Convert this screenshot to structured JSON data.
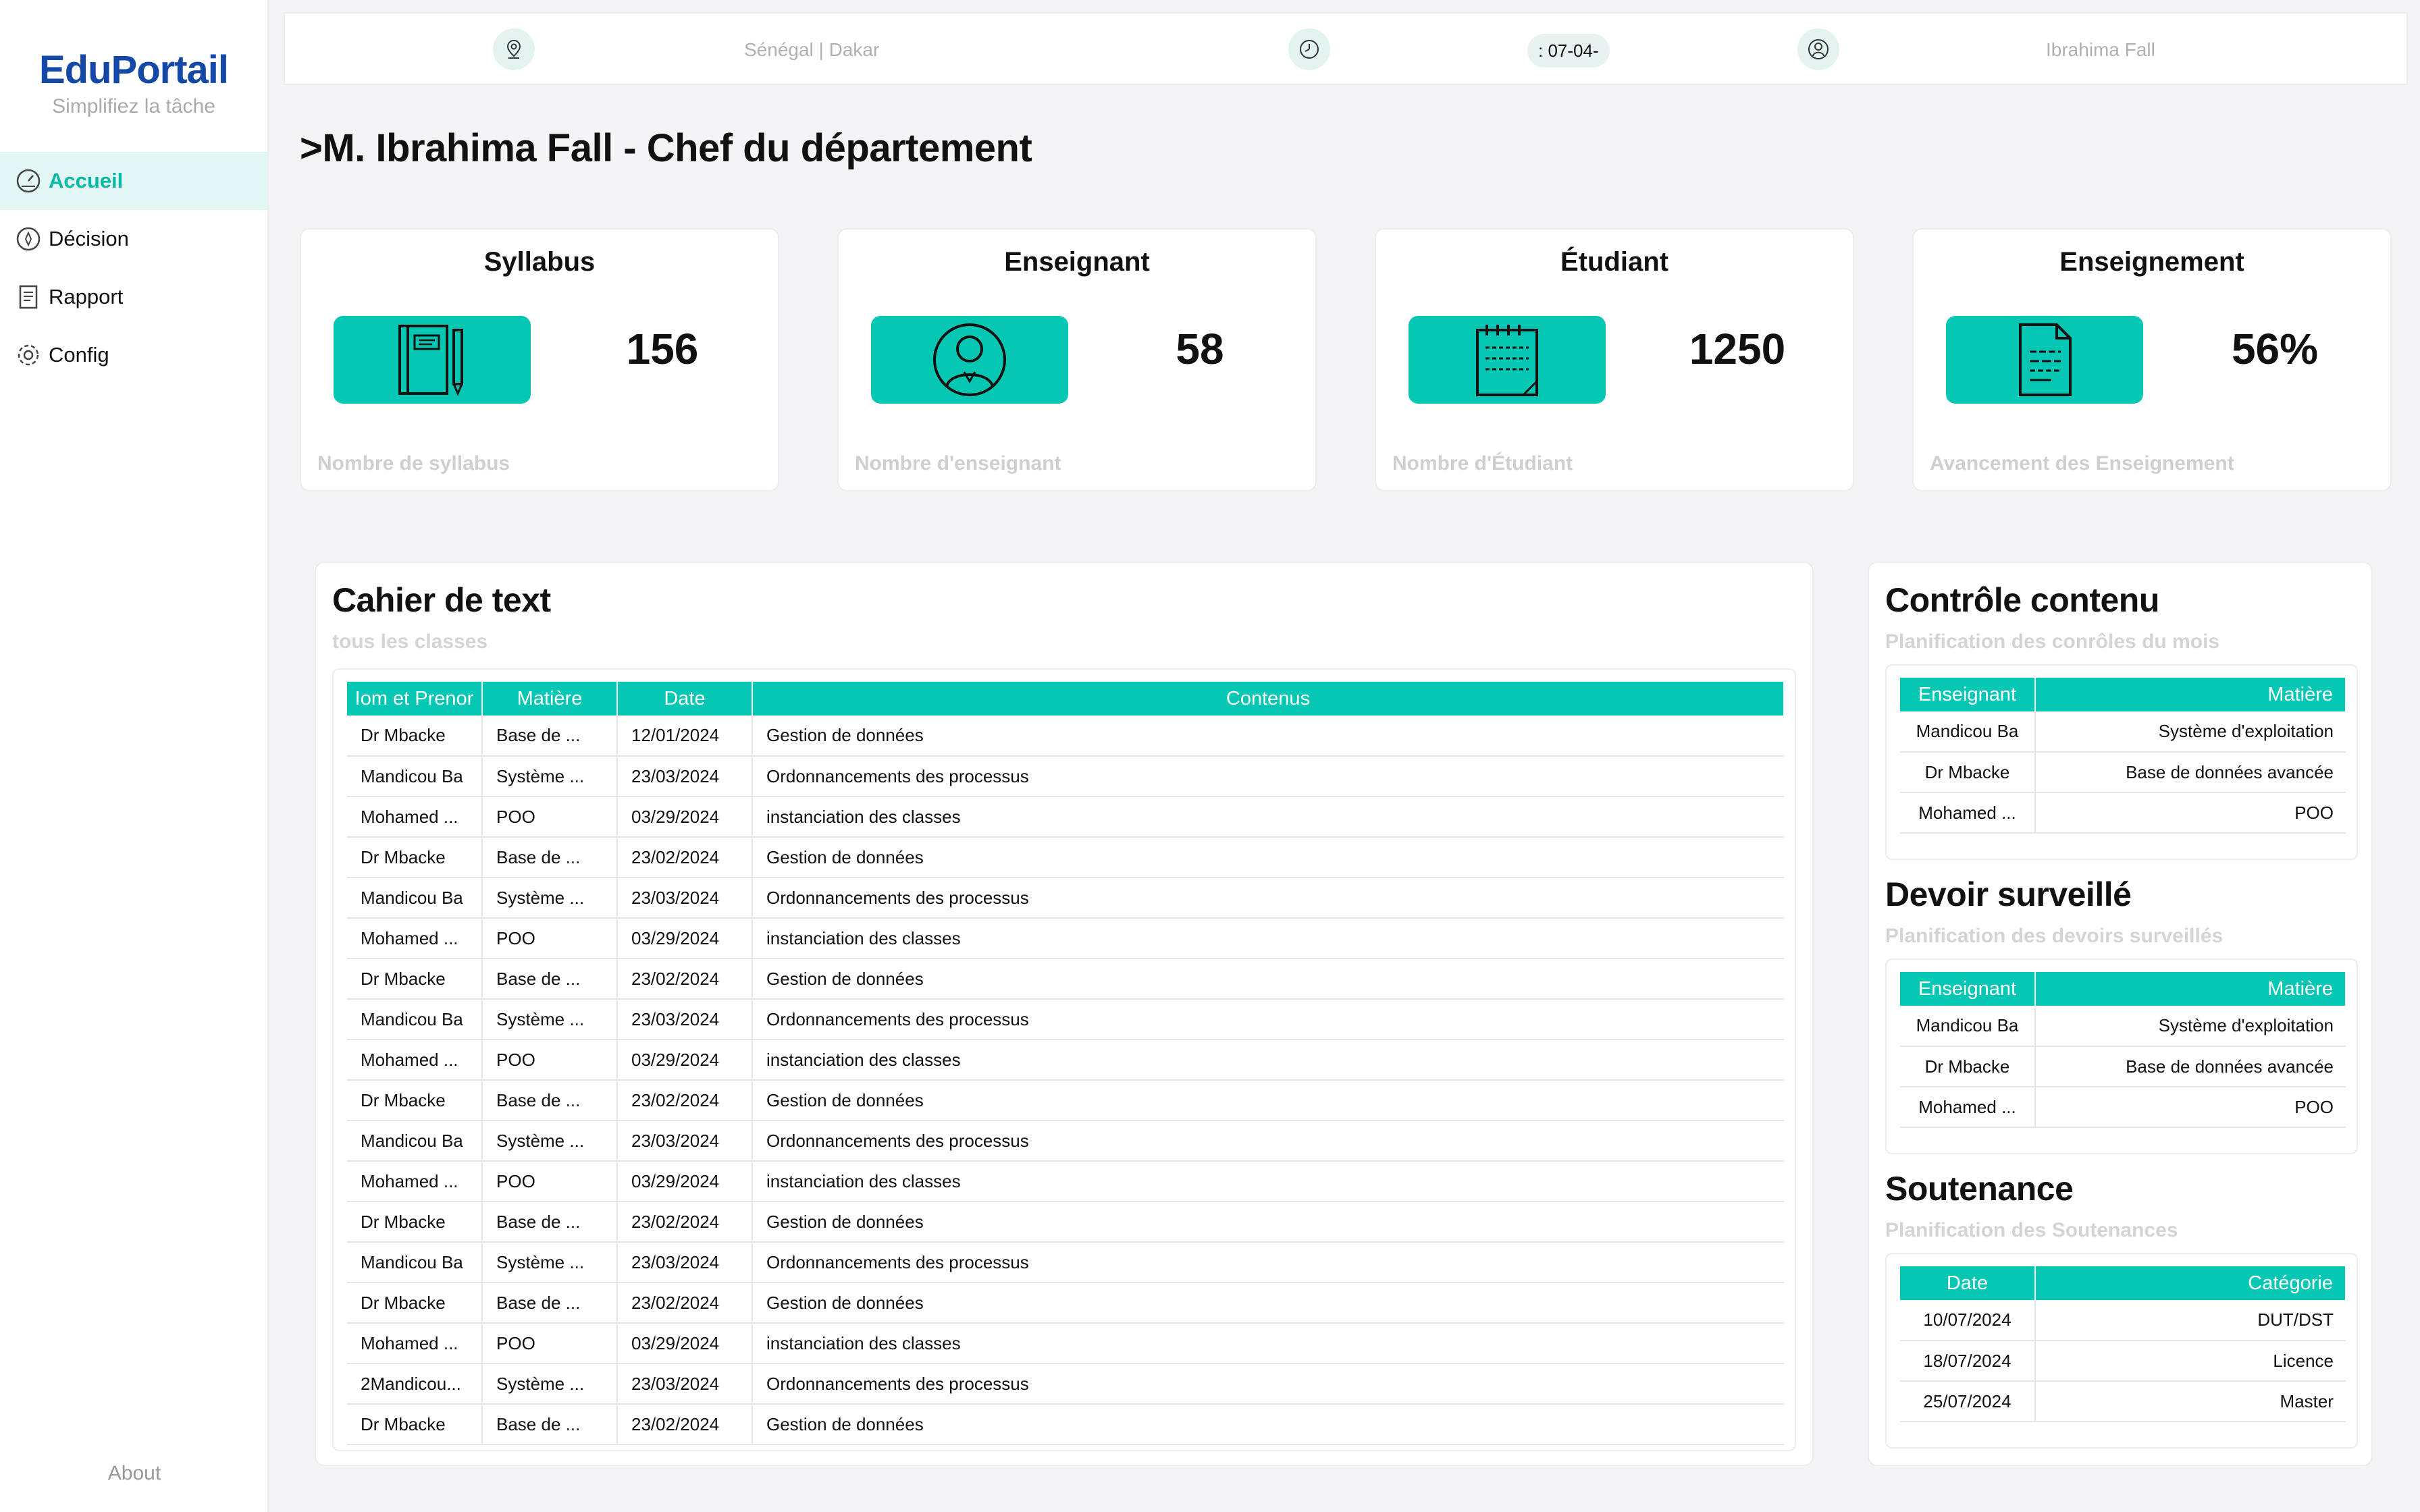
{
  "sidebar": {
    "brand": "EduPortail",
    "tagline": "Simplifiez la tâche",
    "items": [
      {
        "label": "Accueil",
        "icon": "dashboard-icon"
      },
      {
        "label": "Décision",
        "icon": "compass-icon"
      },
      {
        "label": "Rapport",
        "icon": "document-icon"
      },
      {
        "label": "Config",
        "icon": "gear-icon"
      }
    ],
    "about": "About"
  },
  "topbar": {
    "location": "Sénégal | Dakar",
    "date": ": 07-04-",
    "user": "Ibrahima Fall"
  },
  "page_title": ">M. Ibrahima Fall - Chef du département",
  "stats": [
    {
      "title": "Syllabus",
      "value": "156",
      "subtitle": "Nombre de syllabus",
      "icon": "notebook-icon"
    },
    {
      "title": "Enseignant",
      "value": "58",
      "subtitle": "Nombre d'enseignant",
      "icon": "teacher-icon"
    },
    {
      "title": "Étudiant",
      "value": "1250",
      "subtitle": "Nombre d'Étudiant",
      "icon": "notepad-icon"
    },
    {
      "title": "Enseignement",
      "value": "56%",
      "subtitle": "Avancement des Enseignement",
      "icon": "file-text-icon"
    }
  ],
  "cahier": {
    "title": "Cahier de text",
    "subtitle": "tous les classes",
    "columns": [
      "Iom et Prenor",
      "Matière",
      "Date",
      "Contenus"
    ],
    "rows": [
      [
        "Dr Mbacke",
        "Base de ...",
        "12/01/2024",
        "Gestion de données"
      ],
      [
        "Mandicou Ba",
        "Système ...",
        "23/03/2024",
        "Ordonnancements des processus"
      ],
      [
        "Mohamed ...",
        "POO",
        "03/29/2024",
        "instanciation des classes"
      ],
      [
        "Dr Mbacke",
        "Base de ...",
        "23/02/2024",
        "Gestion de données"
      ],
      [
        "Mandicou Ba",
        "Système ...",
        "23/03/2024",
        "Ordonnancements des processus"
      ],
      [
        "Mohamed ...",
        "POO",
        "03/29/2024",
        "instanciation des classes"
      ],
      [
        "Dr Mbacke",
        "Base de ...",
        "23/02/2024",
        "Gestion de données"
      ],
      [
        "Mandicou Ba",
        " Système ...",
        "23/03/2024",
        "Ordonnancements des processus"
      ],
      [
        "Mohamed ...",
        "POO",
        "03/29/2024",
        "instanciation des classes"
      ],
      [
        "Dr Mbacke",
        "Base de ...",
        "23/02/2024",
        "Gestion de données"
      ],
      [
        "Mandicou Ba",
        " Système ...",
        "23/03/2024",
        "Ordonnancements des processus"
      ],
      [
        "Mohamed ...",
        "POO",
        "03/29/2024",
        "instanciation des classes"
      ],
      [
        "Dr Mbacke",
        "Base de ...",
        "23/02/2024",
        "Gestion de données"
      ],
      [
        "Mandicou Ba",
        " Système ...",
        "23/03/2024",
        "Ordonnancements des processus"
      ],
      [
        "Dr Mbacke",
        "Base de ...",
        "23/02/2024",
        "Gestion de données"
      ],
      [
        "Mohamed ...",
        "POO",
        "03/29/2024",
        "instanciation des classes"
      ],
      [
        "2Mandicou...",
        " Système ...",
        "23/03/2024",
        "Ordonnancements des processus"
      ],
      [
        "Dr Mbacke",
        "Base de ...",
        "23/02/2024",
        "Gestion de données"
      ]
    ]
  },
  "controle": {
    "title": "Contrôle contenu",
    "subtitle": "Planification des conrôles du mois",
    "columns": [
      "Enseignant",
      "Matière"
    ],
    "rows": [
      [
        "Mandicou Ba",
        "Système d'exploitation"
      ],
      [
        "Dr Mbacke",
        "Base de données avancée"
      ],
      [
        "Mohamed ...",
        "POO"
      ]
    ]
  },
  "devoir": {
    "title": "Devoir surveillé",
    "subtitle": "Planification des devoirs surveillés",
    "columns": [
      "Enseignant",
      "Matière"
    ],
    "rows": [
      [
        "Mandicou Ba",
        "Système d'exploitation"
      ],
      [
        "Dr Mbacke",
        "Base de données avancée"
      ],
      [
        "Mohamed ...",
        "POO"
      ]
    ]
  },
  "soutenance": {
    "title": "Soutenance",
    "subtitle": "Planification des Soutenances",
    "columns": [
      "Date",
      "Catégorie"
    ],
    "rows": [
      [
        "10/07/2024",
        "DUT/DST"
      ],
      [
        "18/07/2024",
        "Licence"
      ],
      [
        "25/07/2024",
        "Master"
      ]
    ]
  },
  "colors": {
    "accent": "#06c7b3",
    "brand": "#1549a8",
    "active_bg": "#e2f7f4"
  }
}
